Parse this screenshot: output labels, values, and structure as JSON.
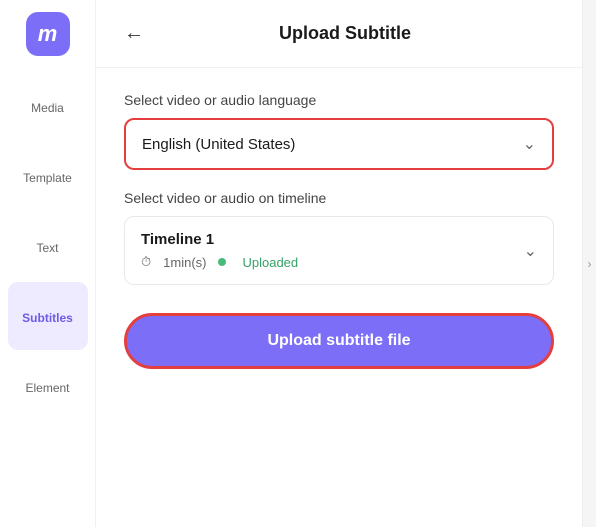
{
  "app": {
    "logo": "m",
    "title": "Upload Subtitle",
    "back_label": "←"
  },
  "sidebar": {
    "items": [
      {
        "id": "media",
        "label": "Media",
        "icon": "media-icon",
        "active": false
      },
      {
        "id": "template",
        "label": "Template",
        "icon": "template-icon",
        "active": false
      },
      {
        "id": "text",
        "label": "Text",
        "icon": "text-icon",
        "active": false
      },
      {
        "id": "subtitles",
        "label": "Subtitles",
        "icon": "subtitles-icon",
        "active": true
      },
      {
        "id": "element",
        "label": "Element",
        "icon": "element-icon",
        "active": false
      }
    ]
  },
  "main": {
    "language_label": "Select video or audio language",
    "language_value": "English (United States)",
    "timeline_label": "Select video or audio on timeline",
    "timeline": {
      "name": "Timeline 1",
      "duration": "1min(s)",
      "status": "Uploaded"
    },
    "upload_button_label": "Upload subtitle file"
  },
  "colors": {
    "accent_purple": "#7c6ef7",
    "border_red": "#e53e3e",
    "uploaded_green": "#38a169",
    "dot_green": "#48bb78"
  }
}
